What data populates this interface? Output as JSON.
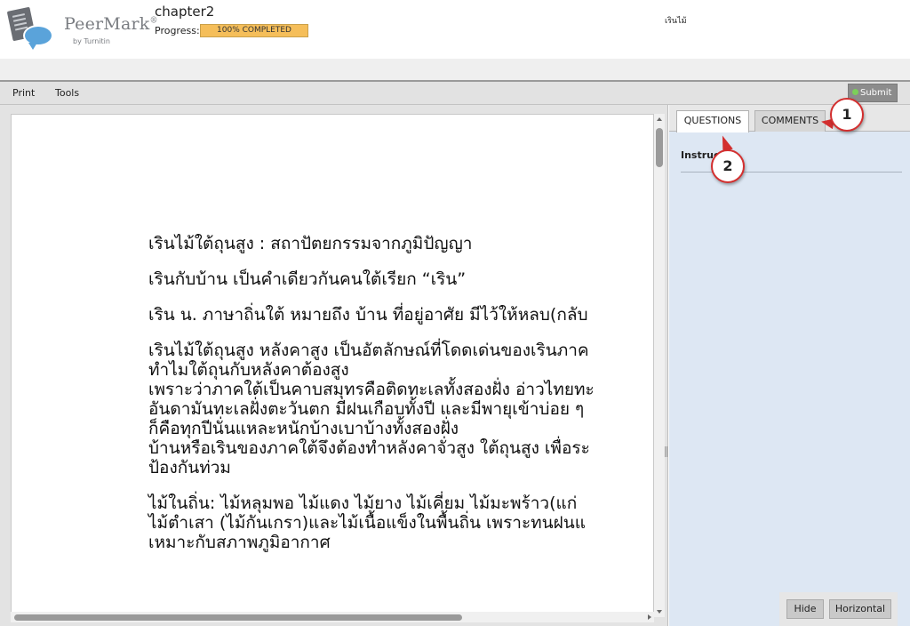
{
  "header": {
    "logo_name": "PeerMark",
    "logo_registered": "®",
    "logo_by": "by Turnitin",
    "document_title": "chapter2",
    "progress_label": "Progress:",
    "progress_percent": 100,
    "progress_text": "100% COMPLETED",
    "user_name": "เรินไม้"
  },
  "toolbar": {
    "print_label": "Print",
    "tools_label": "Tools",
    "submit_label": "Submit"
  },
  "document": {
    "paragraphs": [
      [
        "เรินไม้ใต้ถุนสูง : สถาปัตยกรรมจากภูมิปัญญา"
      ],
      [
        "เรินกับบ้าน เป็นคำเดียวกันคนใต้เรียก “เริน”"
      ],
      [
        "เริน น. ภาษาถิ่นใต้ หมายถึง บ้าน ที่อยู่อาศัย มีไว้ให้หลบ(กลับ"
      ],
      [
        "เรินไม้ใต้ถุนสูง หลังคาสูง เป็นอัตลักษณ์ที่โดดเด่นของเรินภาค",
        "ทำไมใต้ถุนกับหลังคาต้องสูง",
        "เพราะว่าภาคใต้เป็นคาบสมุทรคือติดทะเลทั้งสองฝั่ง อ่าวไทยทะ",
        "อันดามันทะเลฝั่งตะวันตก มีฝนเกือบทั้งปี และมีพายุเข้าบ่อย ๆ",
        "ก็คือทุกปีนั่นแหละหนักบ้างเบาบ้างทั้งสองฝั่ง",
        "บ้านหรือเรินของภาคใต้จึงต้องทำหลังคาจั่วสูง ใต้ถุนสูง เพื่อระ",
        "ป้องกันท่วม"
      ],
      [
        "ไม้ในถิ่น: ไม้หลุมพอ ไม้แดง ไม้ยาง ไม้เคี่ยม ไม้มะพร้าว(แก่",
        "ไม้ตำเสา (ไม้กันเกรา)และไม้เนื้อแข็งในพื้นถิ่น เพราะทนฝนแ",
        "เหมาะกับสภาพภูมิอากาศ"
      ]
    ]
  },
  "side_panel": {
    "tab_questions": "QUESTIONS",
    "tab_comments": "COMMENTS",
    "active_tab": "QUESTIONS",
    "instructions_label": "Instruc",
    "hide_label": "Hide",
    "horizontal_label": "Horizontal"
  },
  "annotations": {
    "marker_1": "1",
    "marker_2": "2",
    "marker_color": "#d32f2f"
  }
}
